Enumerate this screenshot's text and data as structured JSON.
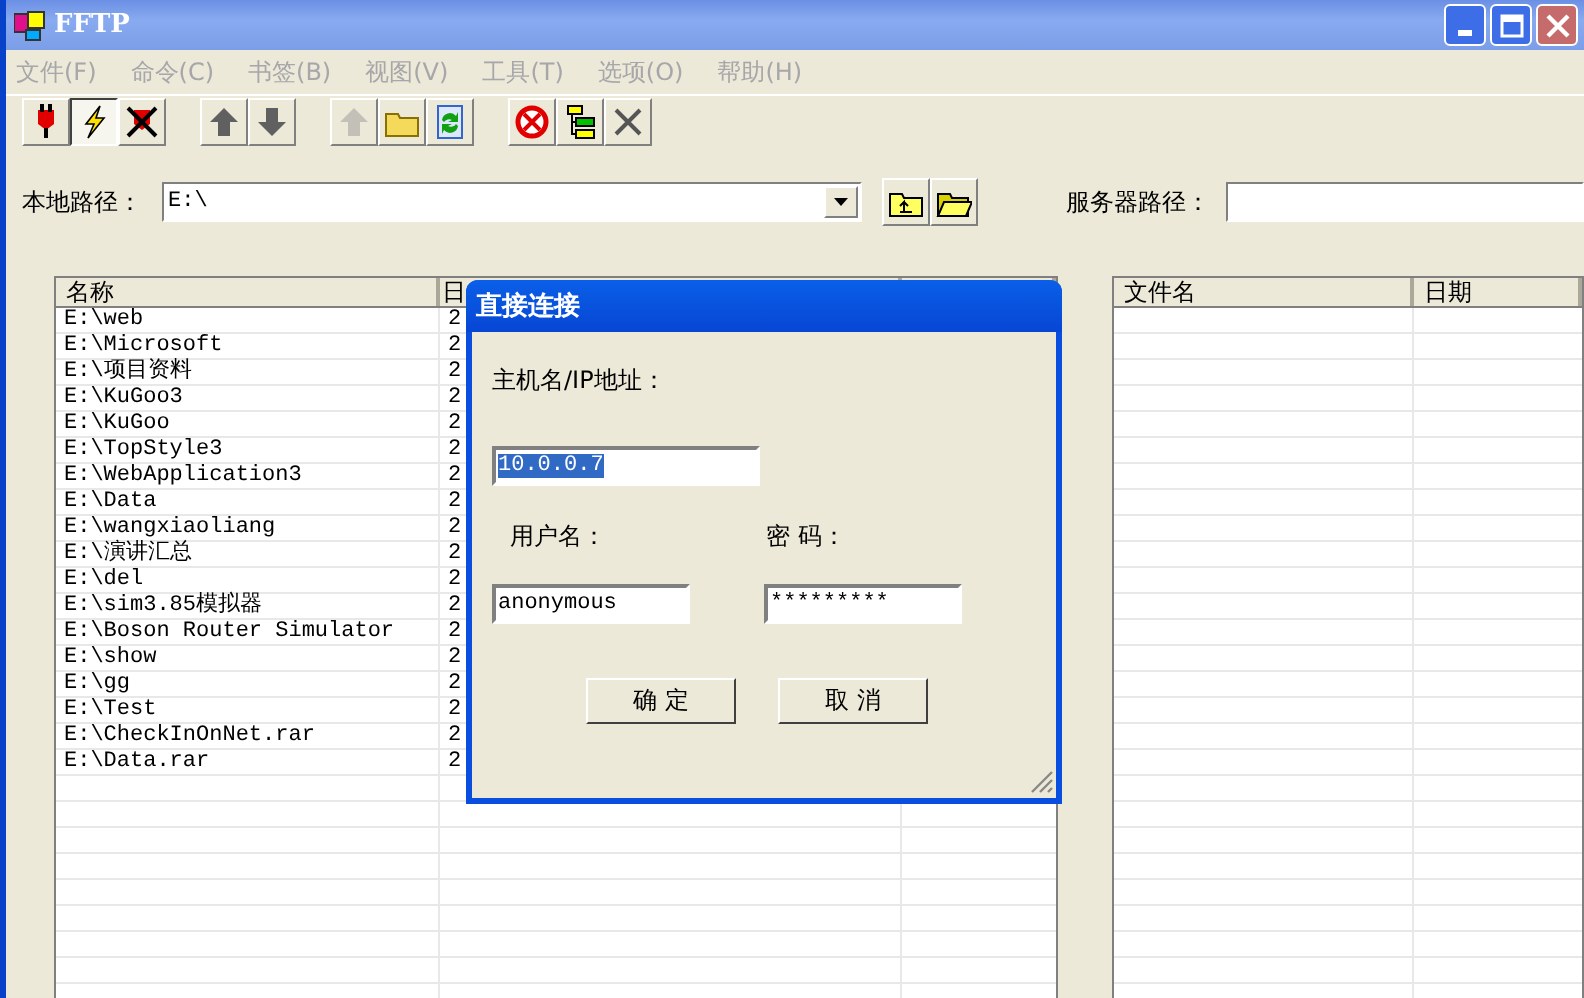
{
  "window": {
    "title": "FFTP"
  },
  "menu": [
    {
      "label": "文件(F)",
      "disabled": true
    },
    {
      "label": "命令(C)",
      "disabled": true
    },
    {
      "label": "书签(B)",
      "disabled": true
    },
    {
      "label": "视图(V)",
      "disabled": true
    },
    {
      "label": "工具(T)",
      "disabled": true
    },
    {
      "label": "选项(O)",
      "disabled": true
    },
    {
      "label": "帮助(H)",
      "disabled": true
    }
  ],
  "toolbar": [
    [
      {
        "kind": "plug",
        "pressed": false,
        "disabled": false
      },
      {
        "kind": "bolt",
        "pressed": true,
        "disabled": false
      },
      {
        "kind": "unplug",
        "pressed": false,
        "disabled": false
      }
    ],
    [
      {
        "kind": "up",
        "pressed": false,
        "disabled": false
      },
      {
        "kind": "down",
        "pressed": false,
        "disabled": false
      }
    ],
    [
      {
        "kind": "parent",
        "pressed": false,
        "disabled": true
      },
      {
        "kind": "folder",
        "pressed": false,
        "disabled": false
      },
      {
        "kind": "refresh",
        "pressed": false,
        "disabled": false
      }
    ],
    [
      {
        "kind": "stop",
        "pressed": false,
        "disabled": false
      },
      {
        "kind": "tree",
        "pressed": false,
        "disabled": false
      },
      {
        "kind": "cancel",
        "pressed": false,
        "disabled": false
      }
    ]
  ],
  "local_path": {
    "label": "本地路径：",
    "value": "E:\\"
  },
  "server_path": {
    "label": "服务器路径："
  },
  "local_list": {
    "columns": [
      "名称",
      "日"
    ],
    "rows": [
      {
        "name": "E:\\web",
        "column_2": "2"
      },
      {
        "name": "E:\\Microsoft",
        "column_2": "2"
      },
      {
        "name": "E:\\项目资料",
        "column_2": "2"
      },
      {
        "name": "E:\\KuGoo3",
        "column_2": "2"
      },
      {
        "name": "E:\\KuGoo",
        "column_2": "2"
      },
      {
        "name": "E:\\TopStyle3",
        "column_2": "2"
      },
      {
        "name": "E:\\WebApplication3",
        "column_2": "2"
      },
      {
        "name": "E:\\Data",
        "column_2": "2"
      },
      {
        "name": "E:\\wangxiaoliang",
        "column_2": "2"
      },
      {
        "name": "E:\\演讲汇总",
        "column_2": "2"
      },
      {
        "name": "E:\\del",
        "column_2": "2"
      },
      {
        "name": "E:\\sim3.85模拟器",
        "column_2": "2"
      },
      {
        "name": "E:\\Boson Router Simulator",
        "column_2": "2"
      },
      {
        "name": "E:\\show",
        "column_2": "2"
      },
      {
        "name": "E:\\gg",
        "column_2": "2"
      },
      {
        "name": "E:\\Test",
        "column_2": "2"
      },
      {
        "name": "E:\\CheckInOnNet.rar",
        "column_2": "2"
      },
      {
        "name": "E:\\Data.rar",
        "column_2": "2"
      }
    ]
  },
  "server_list": {
    "columns": [
      "文件名",
      "日期"
    ]
  },
  "dialog": {
    "title": "直接连接",
    "host_label": "主机名/IP地址：",
    "host_value": "10.0.0.7",
    "user_label": "用户名：",
    "user_value": "anonymous",
    "password_label": "密 码：",
    "password_value": "*********",
    "buttons": [
      "确 定",
      "取 消"
    ]
  }
}
